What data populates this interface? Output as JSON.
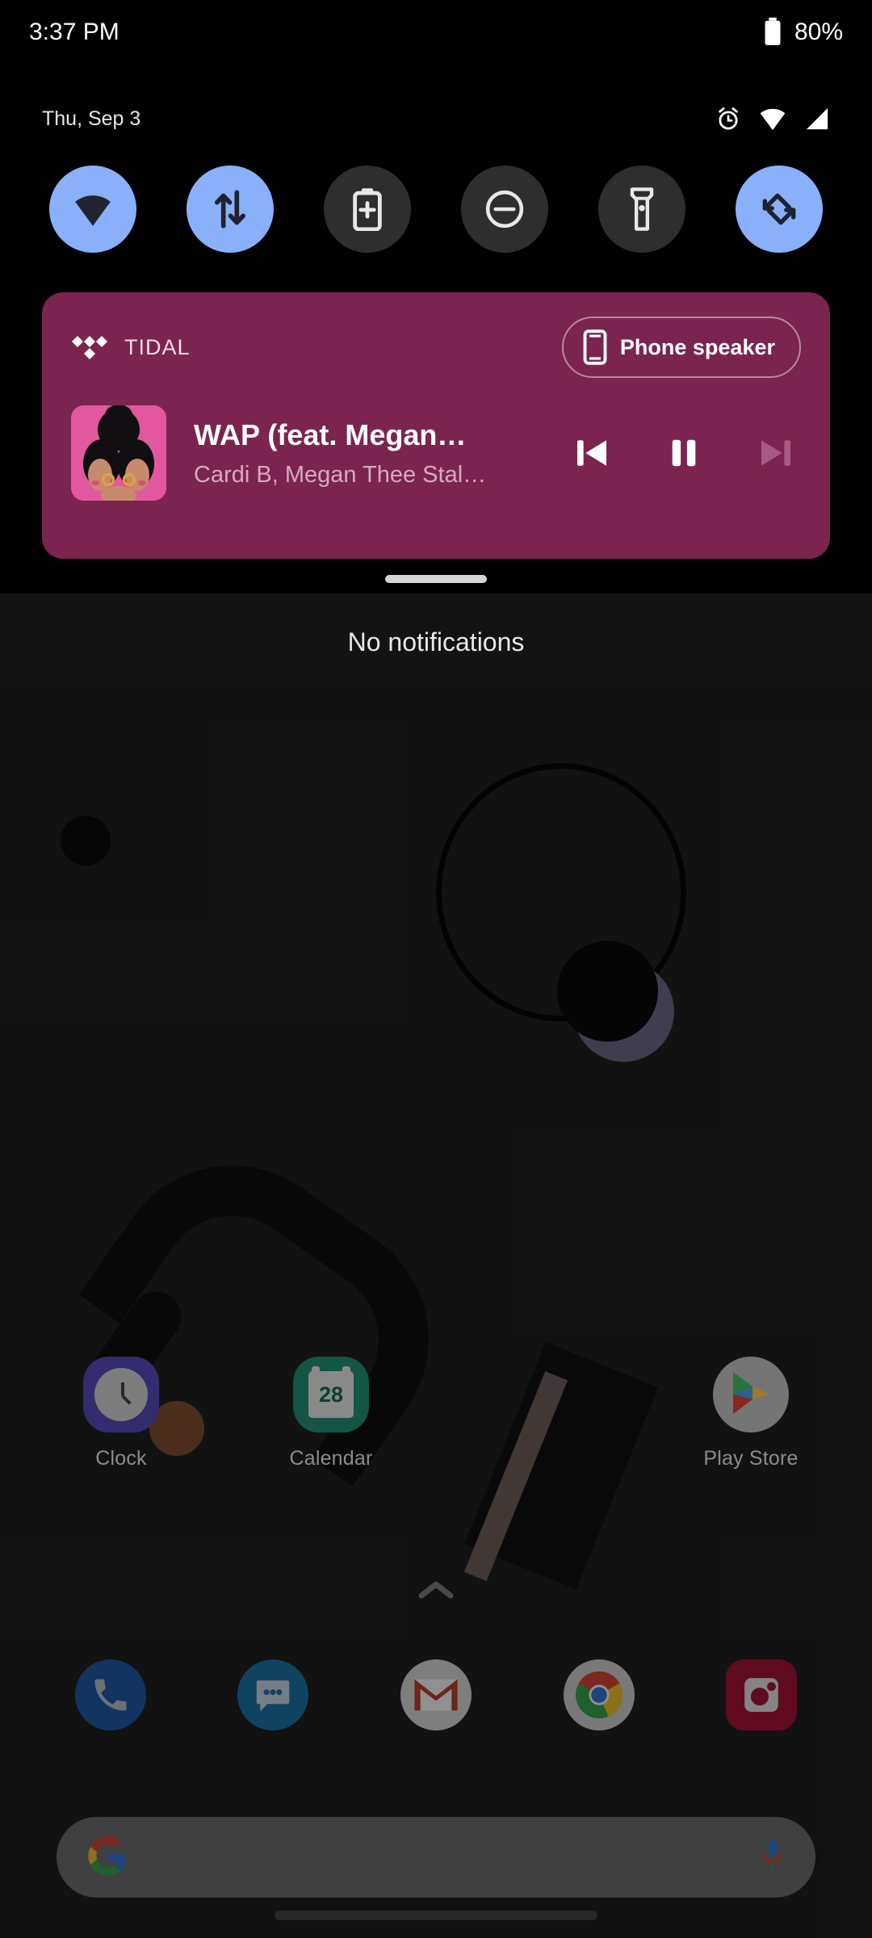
{
  "status_bar": {
    "time": "3:37 PM",
    "battery_percent": "80%",
    "battery_icon": "battery-icon"
  },
  "shade": {
    "date": "Thu, Sep 3",
    "status_icons": [
      "alarm-icon",
      "wifi-icon",
      "cellular-signal-icon"
    ],
    "quick_settings": [
      {
        "name": "wifi",
        "icon": "wifi-icon",
        "state": "on"
      },
      {
        "name": "mobile-data",
        "icon": "mobile-data-icon",
        "state": "on"
      },
      {
        "name": "battery-saver",
        "icon": "battery-saver-icon",
        "state": "off"
      },
      {
        "name": "do-not-disturb",
        "icon": "do-not-disturb-icon",
        "state": "off"
      },
      {
        "name": "flashlight",
        "icon": "flashlight-icon",
        "state": "off"
      },
      {
        "name": "auto-rotate",
        "icon": "auto-rotate-icon",
        "state": "on"
      }
    ],
    "no_notifications_text": "No notifications",
    "handle": "shade-drag-handle"
  },
  "media": {
    "app_name": "TIDAL",
    "app_icon": "tidal-logo-icon",
    "output_device": "Phone speaker",
    "output_icon": "phone-speaker-icon",
    "track_title": "WAP (feat. Megan…",
    "track_artist": "Cardi B, Megan Thee Stal…",
    "album_art": "wap-album-art",
    "controls": [
      {
        "name": "previous",
        "icon": "skip-previous-icon",
        "enabled": true
      },
      {
        "name": "pause",
        "icon": "pause-icon",
        "enabled": true
      },
      {
        "name": "next",
        "icon": "skip-next-icon",
        "enabled": false
      }
    ],
    "accent_color": "#7b2450"
  },
  "home": {
    "apps": [
      {
        "label": "Clock",
        "icon": "clock-app-icon"
      },
      {
        "label": "Calendar",
        "icon": "calendar-app-icon",
        "day": "28"
      },
      {
        "label": "",
        "icon": ""
      },
      {
        "label": "Play Store",
        "icon": "play-store-app-icon"
      }
    ],
    "drawer_indicator": "chevron-up-icon",
    "dock": [
      {
        "label": "Phone",
        "icon": "phone-app-icon"
      },
      {
        "label": "Messages",
        "icon": "messages-app-icon"
      },
      {
        "label": "Gmail",
        "icon": "gmail-app-icon"
      },
      {
        "label": "Chrome",
        "icon": "chrome-app-icon"
      },
      {
        "label": "Camera",
        "icon": "camera-app-icon"
      }
    ],
    "search": {
      "google_icon": "google-g-icon",
      "mic_icon": "microphone-icon",
      "placeholder": ""
    },
    "nav_pill": "home-gesture-pill"
  },
  "colors": {
    "accent_on": "#8ab0fa",
    "tile_off": "#2e2e2e",
    "media_bg": "#7b2450",
    "wallpaper": "#1b1b1b"
  }
}
